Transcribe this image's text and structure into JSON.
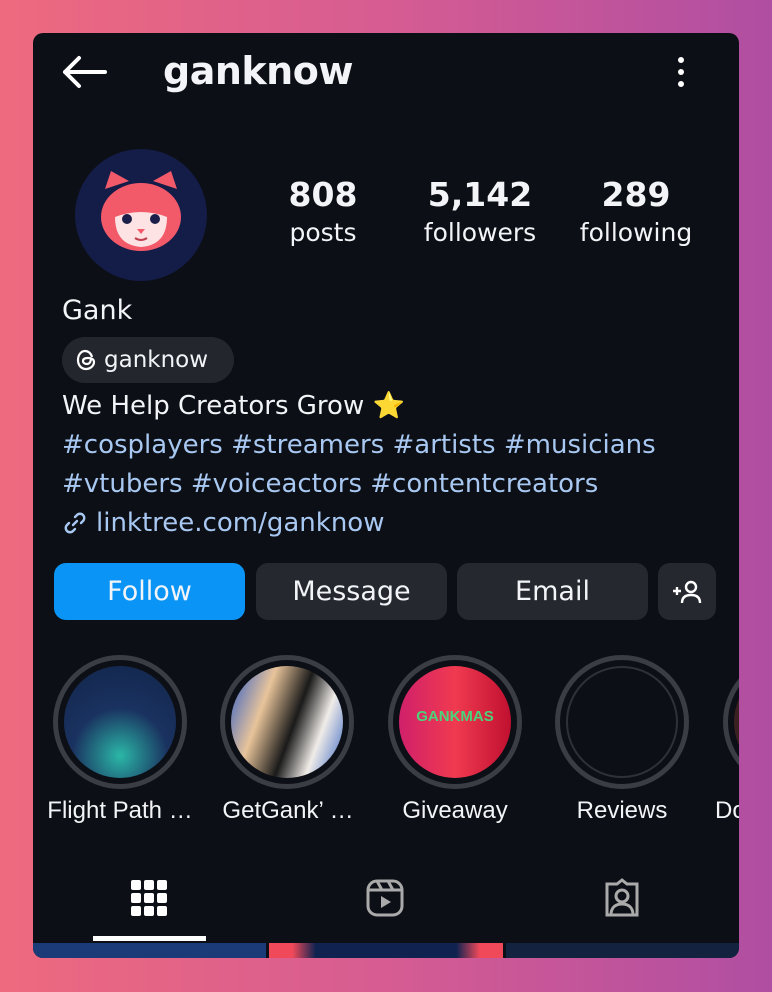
{
  "header": {
    "username": "ganknow",
    "back_icon": "arrow-left-icon",
    "more_icon": "kebab-menu-icon"
  },
  "profile": {
    "display_name": "Gank",
    "threads_handle": "ganknow",
    "stats": [
      {
        "value": "808",
        "label": "posts"
      },
      {
        "value": "5,142",
        "label": "followers"
      },
      {
        "value": "289",
        "label": "following"
      }
    ],
    "bio": "We Help Creators Grow ⭐",
    "hashtags_line1": "#cosplayers #streamers #artists #musicians",
    "hashtags_line2": "#vtubers #voiceactors #contentcreators",
    "link": "linktree.com/ganknow"
  },
  "actions": {
    "follow": "Follow",
    "message": "Message",
    "email": "Email",
    "follow_color": "#0095f6"
  },
  "highlights": [
    {
      "label": "Flight Path …"
    },
    {
      "label": "GetGank’ …"
    },
    {
      "label": "Giveaway"
    },
    {
      "label": "Reviews"
    },
    {
      "label": "Do"
    }
  ],
  "tabs": [
    {
      "icon": "grid-icon",
      "active": true
    },
    {
      "icon": "reels-icon"
    },
    {
      "icon": "tagged-icon"
    }
  ]
}
